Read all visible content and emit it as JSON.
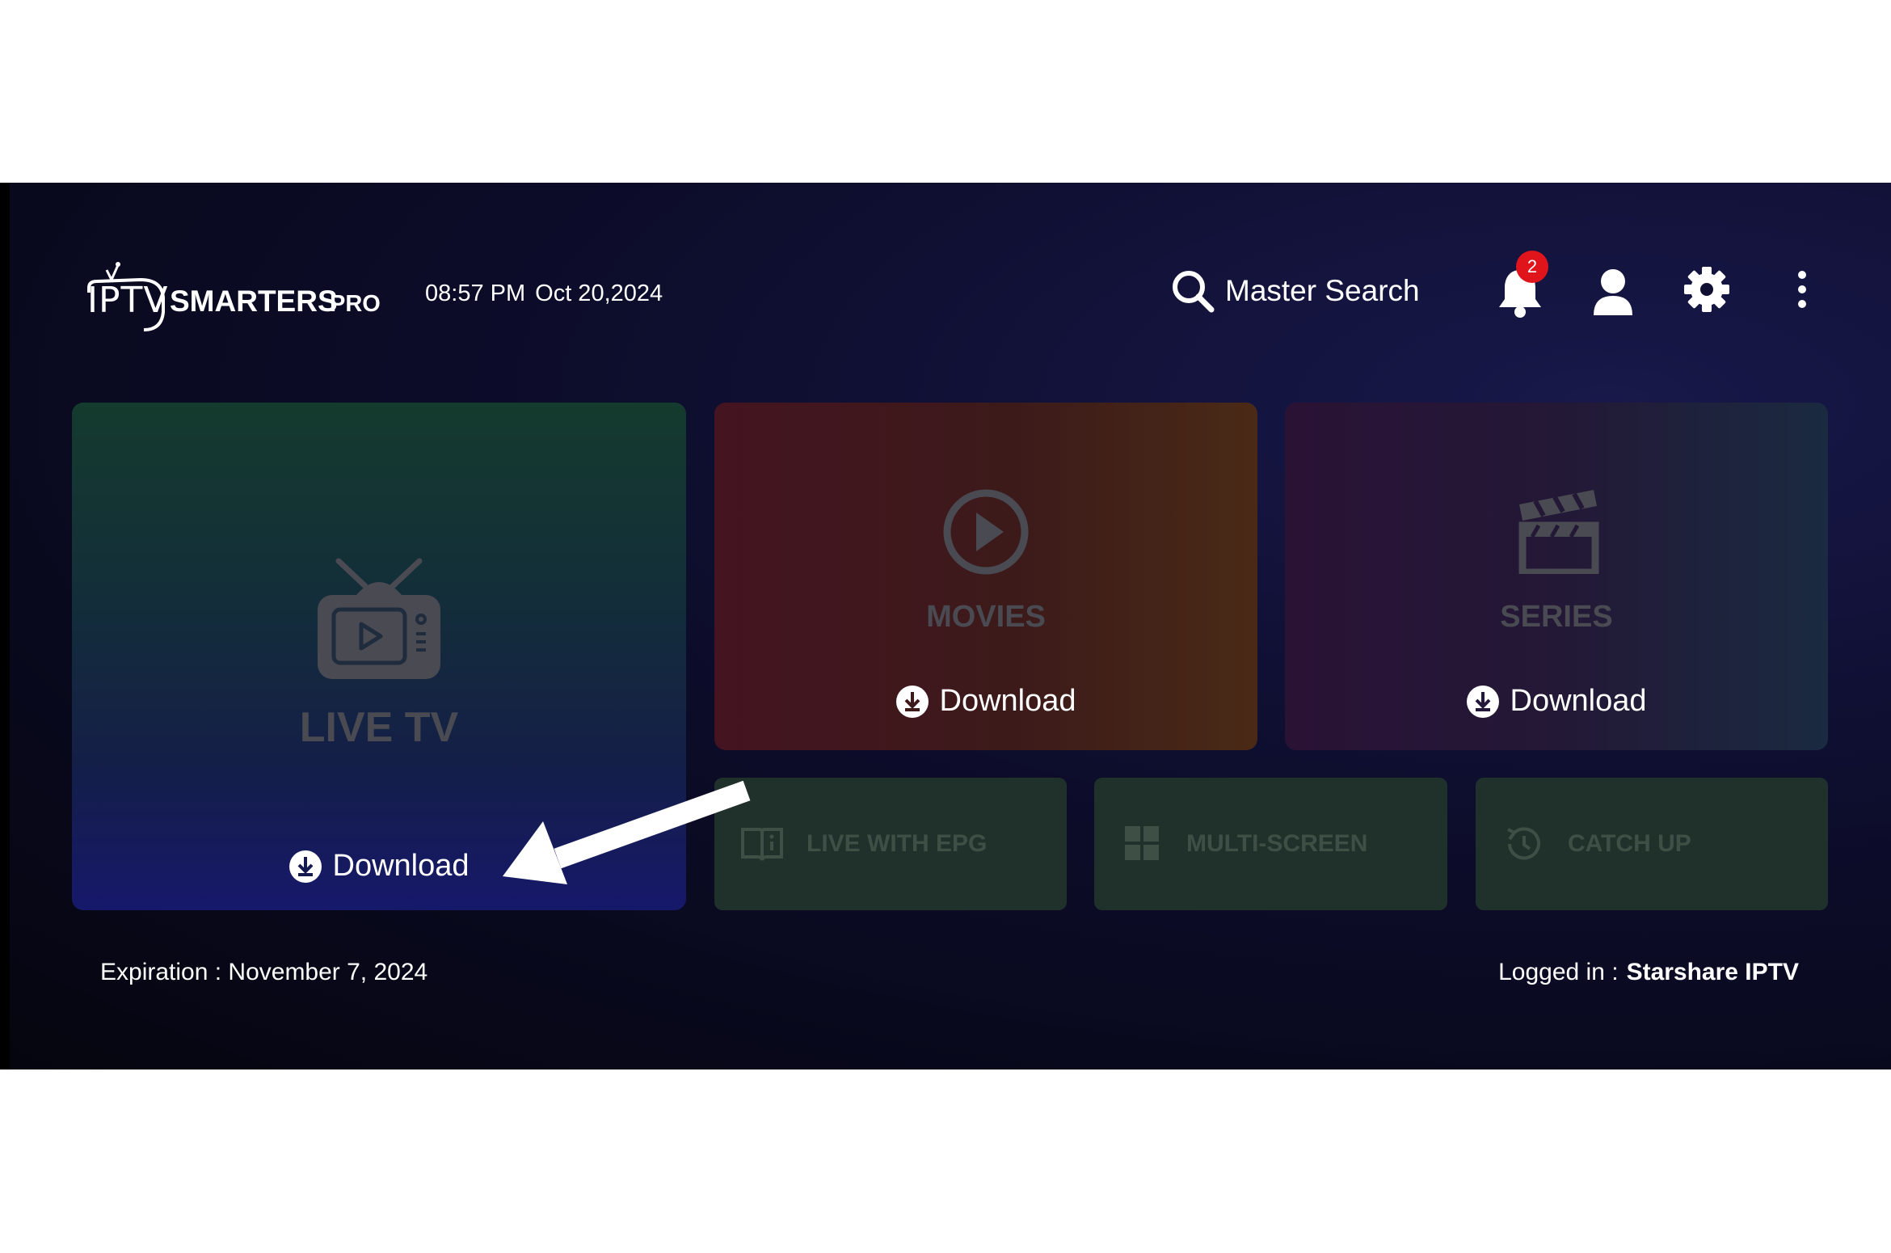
{
  "header": {
    "logo_iptv": "IPTV",
    "logo_smarters": "SMARTERS",
    "logo_pro": "PRO",
    "time": "08:57 PM",
    "date": "Oct 20,2024",
    "search_label": "Master Search",
    "notification_count": "2",
    "icons": [
      "search-icon",
      "bell-icon",
      "user-icon",
      "gear-icon",
      "more-vertical-icon"
    ]
  },
  "tiles": {
    "live": {
      "title": "LIVE TV",
      "download": "Download",
      "icon": "tv-icon"
    },
    "movies": {
      "title": "MOVIES",
      "download": "Download",
      "icon": "play-circle-icon"
    },
    "series": {
      "title": "SERIES",
      "download": "Download",
      "icon": "clapperboard-icon"
    }
  },
  "small_tiles": [
    {
      "label": "LIVE WITH EPG",
      "icon": "book-icon"
    },
    {
      "label": "MULTI-SCREEN",
      "icon": "grid-icon"
    },
    {
      "label": "CATCH UP",
      "icon": "history-icon"
    }
  ],
  "footer": {
    "expiration": "Expiration : November 7, 2024",
    "logged_in_label": "Logged in :",
    "user_name": "Starshare IPTV"
  },
  "colors": {
    "badge": "#e0151b",
    "live_tile_top": "#143b2e",
    "live_tile_bottom": "#16186a",
    "movies_tile": "#441420",
    "series_tile": "#2a1235",
    "small_tile": "#20312b"
  }
}
